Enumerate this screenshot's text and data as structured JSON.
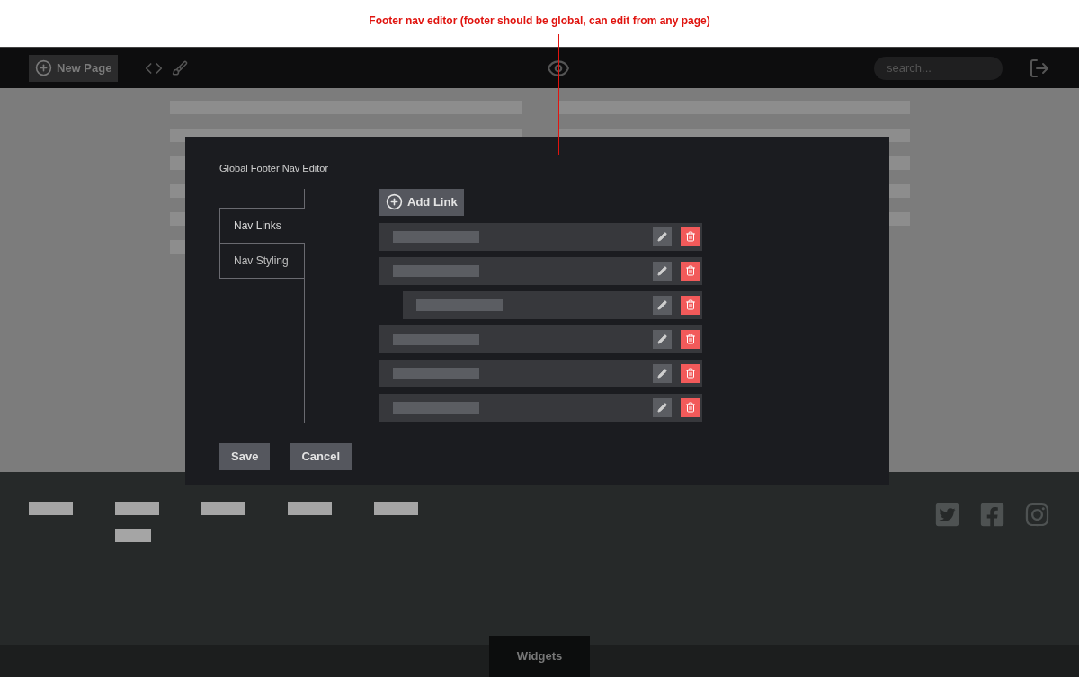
{
  "annotation": {
    "text": "Footer nav editor (footer should be global, can edit from any page)"
  },
  "toolbar": {
    "new_page": "New Page",
    "search": {
      "placeholder": "search..."
    }
  },
  "editor": {
    "title": "Global Footer Nav Editor",
    "tabs": [
      {
        "label": "Nav Links",
        "selected": true
      },
      {
        "label": "Nav Styling",
        "selected": false
      }
    ],
    "add_link": "Add Link",
    "links": [
      {
        "kind": "link"
      },
      {
        "kind": "link",
        "children": [
          {
            "kind": "link"
          }
        ]
      },
      {
        "kind": "link"
      },
      {
        "kind": "link"
      },
      {
        "kind": "link"
      }
    ],
    "buttons": [
      "Save",
      "Cancel"
    ]
  },
  "bottom_bar": {
    "tab": "Widgets"
  }
}
